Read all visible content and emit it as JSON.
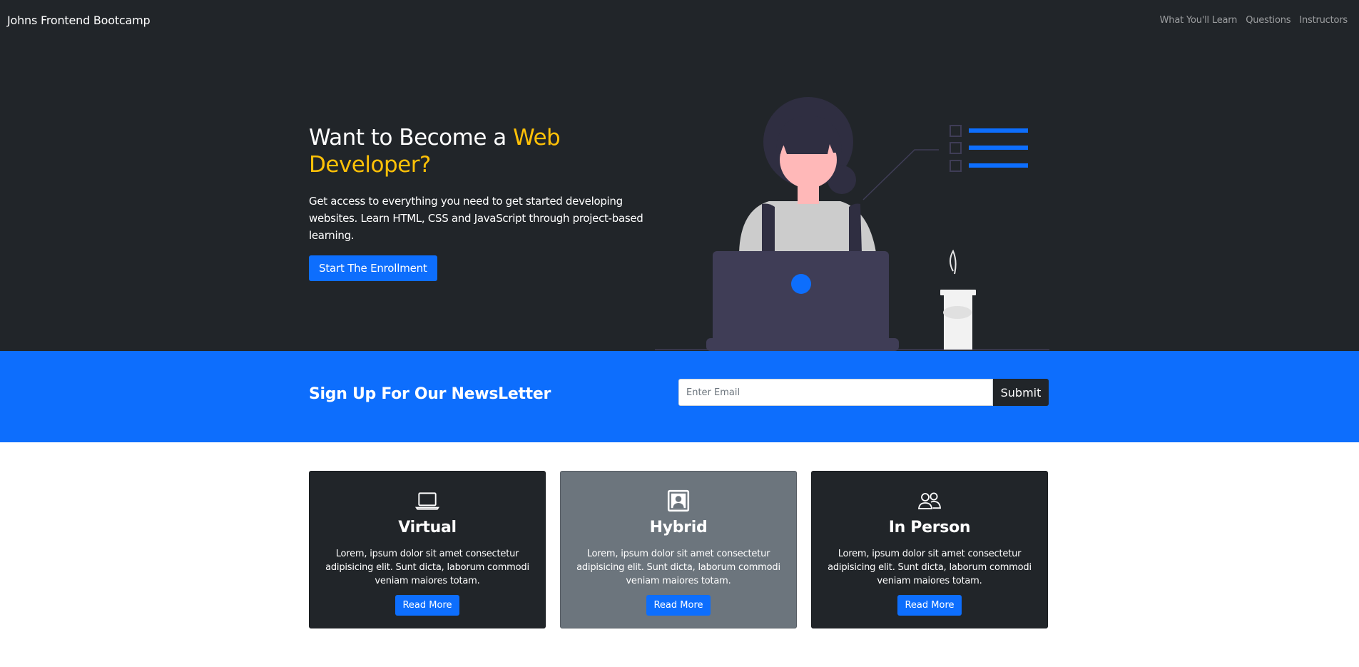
{
  "navbar": {
    "brand": "Johns Frontend Bootcamp",
    "links": [
      "What You'll Learn",
      "Questions",
      "Instructors"
    ]
  },
  "hero": {
    "title_prefix": "Want to Become a ",
    "title_accent": "Web Developer?",
    "lead": "Get access to everything you need to get started developing websites. Learn HTML, CSS and JavaScript through project-based learning.",
    "button_label": "Start The Enrollment",
    "illustration": "woman-at-laptop-illustration"
  },
  "newsletter": {
    "title": "Sign Up For Our NewsLetter",
    "input_placeholder": "Enter Email",
    "input_value": "",
    "submit_label": "Submit"
  },
  "cards": [
    {
      "icon": "laptop-icon",
      "title": "Virtual",
      "text": "Lorem, ipsum dolor sit amet consectetur adipisicing elit. Sunt dicta, laborum commodi veniam maiores totam.",
      "button_label": "Read More",
      "theme": "dark"
    },
    {
      "icon": "person-badge-icon",
      "title": "Hybrid",
      "text": "Lorem, ipsum dolor sit amet consectetur adipisicing elit. Sunt dicta, laborum commodi veniam maiores totam.",
      "button_label": "Read More",
      "theme": "gray"
    },
    {
      "icon": "people-icon",
      "title": "In Person",
      "text": "Lorem, ipsum dolor sit amet consectetur adipisicing elit. Sunt dicta, laborum commodi veniam maiores totam.",
      "button_label": "Read More",
      "theme": "dark"
    }
  ],
  "colors": {
    "dark": "#212529",
    "primary": "#0d6efd",
    "accent": "#ffc107",
    "gray": "#6c757d"
  }
}
